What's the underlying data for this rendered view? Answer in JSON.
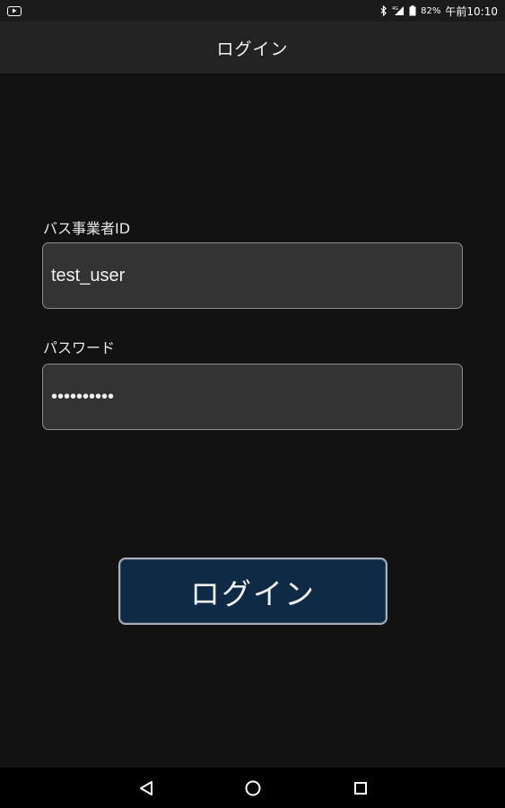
{
  "status_bar": {
    "battery_percent": "82%",
    "clock": "午前10:10",
    "icons": [
      "youtube-icon",
      "bluetooth-icon",
      "signal-icon",
      "battery-icon"
    ]
  },
  "title_bar": {
    "title": "ログイン"
  },
  "form": {
    "user_label": "バス事業者ID",
    "user_value": "test_user",
    "password_label": "パスワード",
    "password_value": "••••••••••"
  },
  "login_button": {
    "label": "ログイン"
  },
  "nav_bar": {
    "icons": [
      "back-icon",
      "home-icon",
      "recents-icon"
    ]
  },
  "colors": {
    "background": "#121212",
    "title_bar": "#232323",
    "field_bg": "#333333",
    "button_bg": "#0e2a45"
  }
}
